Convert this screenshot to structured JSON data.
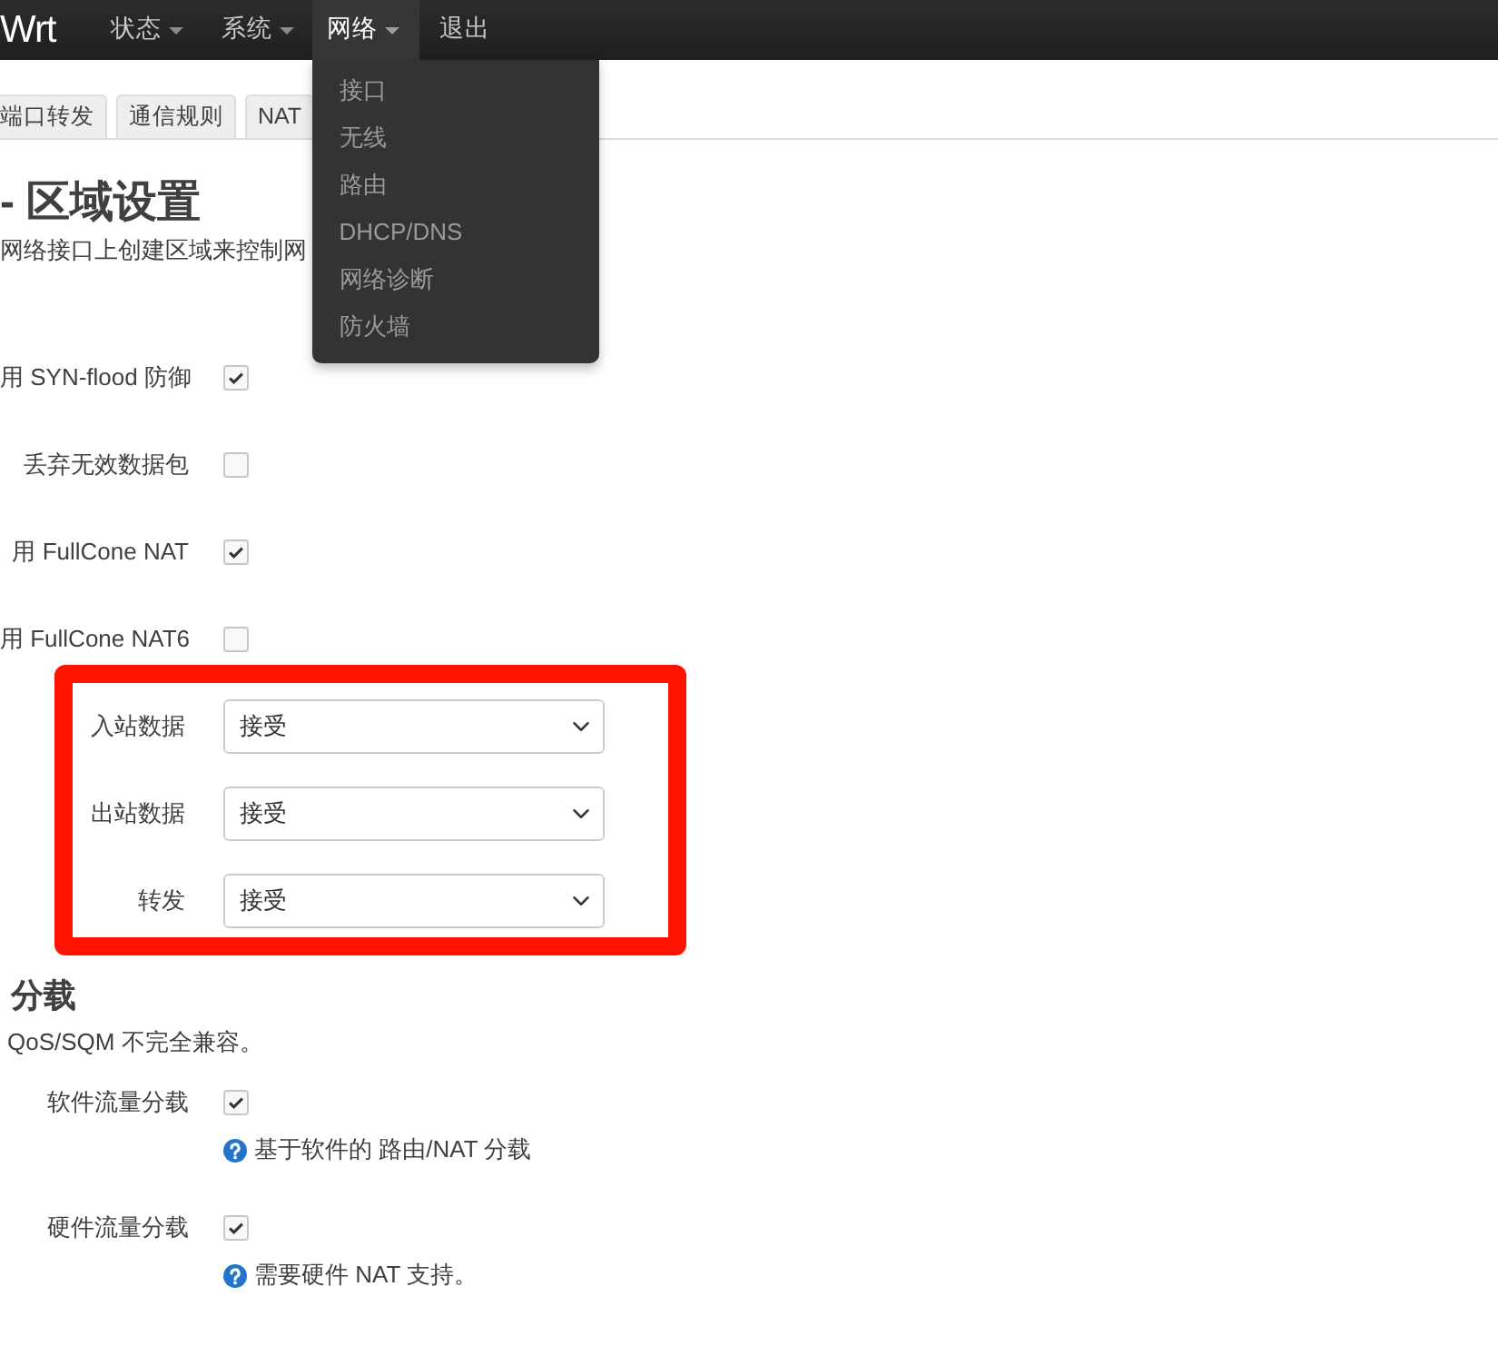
{
  "navbar": {
    "brand": "Wrt",
    "items": [
      {
        "label": "状态",
        "dropdown": true,
        "selected": false
      },
      {
        "label": "系统",
        "dropdown": true,
        "selected": false
      },
      {
        "label": "网络",
        "dropdown": true,
        "selected": true
      },
      {
        "label": "退出",
        "dropdown": false,
        "selected": false
      }
    ]
  },
  "open_menu": {
    "items": [
      "接口",
      "无线",
      "路由",
      "DHCP/DNS",
      "网络诊断",
      "防火墙"
    ]
  },
  "tabs": [
    {
      "label": "端口转发",
      "selected": false
    },
    {
      "label": "通信规则",
      "selected": false
    },
    {
      "label": "NAT",
      "selected": false
    }
  ],
  "section": {
    "title": "- 区域设置",
    "description": "网络接口上创建区域来控制网",
    "options": [
      {
        "label": "用 SYN-flood 防御",
        "checked": true
      },
      {
        "label": "丢弃无效数据包",
        "checked": false
      },
      {
        "label": "用 FullCone NAT",
        "checked": true
      },
      {
        "label": "用 FullCone NAT6",
        "checked": false
      }
    ]
  },
  "highlight_frame": {
    "rows": [
      {
        "label": "入站数据",
        "value": "接受"
      },
      {
        "label": "出站数据",
        "value": "接受"
      },
      {
        "label": "转发",
        "value": "接受"
      }
    ]
  },
  "offload": {
    "title": "分载",
    "description": "QoS/SQM 不完全兼容。",
    "options": [
      {
        "label": "软件流量分载",
        "checked": true,
        "help": "基于软件的 路由/NAT 分载"
      },
      {
        "label": "硬件流量分载",
        "checked": true,
        "help": "需要硬件 NAT 支持。"
      }
    ]
  }
}
